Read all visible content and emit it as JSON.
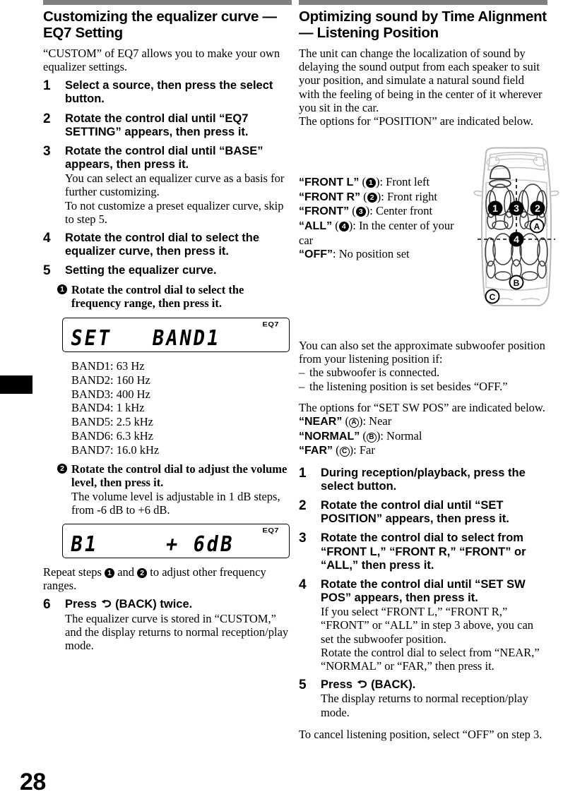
{
  "page": {
    "number": "28"
  },
  "left_column": {
    "title": "Customizing the equalizer curve — EQ7 Setting",
    "intro": "“CUSTOM” of EQ7 allows you to make your own equalizer settings.",
    "steps": [
      {
        "num": "1",
        "head": "Select a source, then press the select button.",
        "sub": ""
      },
      {
        "num": "2",
        "head": "Rotate the control dial until “EQ7 SETTING” appears, then press it.",
        "sub": ""
      },
      {
        "num": "3",
        "head": "Rotate the control dial until “BASE” appears, then press it.",
        "sub": "You can select an equalizer curve as a basis for further customizing.\nTo not customize a preset equalizer curve, skip to step 5."
      },
      {
        "num": "4",
        "head": "Rotate the control dial to select the equalizer curve, then press it.",
        "sub": ""
      },
      {
        "num": "5",
        "head": "Setting the equalizer curve.",
        "sub": ""
      }
    ],
    "substep1": {
      "bullet": "1",
      "head": "Rotate the control dial to select the frequency range, then press it."
    },
    "lcd1": {
      "text": "SET   BAND1",
      "indicator": "EQ7"
    },
    "bands": [
      "BAND1: 63 Hz",
      "BAND2: 160 Hz",
      "BAND3: 400 Hz",
      "BAND4: 1 kHz",
      "BAND5: 2.5 kHz",
      "BAND6: 6.3 kHz",
      "BAND7: 16.0 kHz"
    ],
    "substep2": {
      "bullet": "2",
      "head": "Rotate the control dial to adjust the volume level, then press it.",
      "sub": "The volume level is adjustable in 1 dB steps, from -6 dB to +6 dB."
    },
    "lcd2": {
      "text": "B1     + 6dB",
      "indicator": "EQ7"
    },
    "repeat_prefix": "Repeat steps ",
    "repeat_mid": " and ",
    "repeat_suffix": " to adjust other frequency ranges.",
    "repeat_b1": "1",
    "repeat_b2": "2",
    "step6": {
      "num": "6",
      "head_pre": "Press ",
      "head_post": " (BACK) twice.",
      "sub": "The equalizer curve is stored in “CUSTOM,” and the display returns to normal reception/play mode."
    }
  },
  "right_column": {
    "title": "Optimizing sound by Time Alignment — Listening Position",
    "intro1": "The unit can change the localization of sound by delaying the sound output from each speaker to suit your position, and simulate a natural sound field with the feeling of being in the center of it wherever you sit in the car.",
    "intro2": "The options for “POSITION” are indicated below.",
    "position_options": [
      {
        "label": "“FRONT L”",
        "marker": "1",
        "marker_type": "filled",
        "desc": "): Front left"
      },
      {
        "label": "“FRONT R”",
        "marker": "2",
        "marker_type": "filled",
        "desc": "): Front right"
      },
      {
        "label": "“FRONT”",
        "marker": "3",
        "marker_type": "filled",
        "desc": "): Center front"
      },
      {
        "label": "“ALL”",
        "marker": "4",
        "marker_type": "filled",
        "desc": "): In the center of your car"
      },
      {
        "label": "“OFF”",
        "marker": "",
        "marker_type": "none",
        "desc": ": No position set"
      }
    ],
    "car_diagram": {
      "markers": [
        "1",
        "3",
        "2",
        "4",
        "A",
        "B",
        "C"
      ],
      "caption": ""
    },
    "subwoofer_intro": "You can also set the approximate subwoofer position from your listening position if:",
    "subwoofer_conditions": [
      "the subwoofer is connected.",
      "the listening position is set besides “OFF.”"
    ],
    "sw_options_intro": "The options for “SET SW POS” are indicated below.",
    "sw_options": [
      {
        "label": "“NEAR”",
        "marker": "A",
        "desc": "): Near"
      },
      {
        "label": "“NORMAL”",
        "marker": "B",
        "desc": "): Normal"
      },
      {
        "label": "“FAR”",
        "marker": "C",
        "desc": "): Far"
      }
    ],
    "steps": [
      {
        "num": "1",
        "head": "During reception/playback, press the select button.",
        "sub": ""
      },
      {
        "num": "2",
        "head": "Rotate the control dial until “SET POSITION” appears, then press it.",
        "sub": ""
      },
      {
        "num": "3",
        "head": "Rotate the control dial to select from “FRONT L,” “FRONT R,” “FRONT” or “ALL,” then press it.",
        "sub": ""
      },
      {
        "num": "4",
        "head": "Rotate the control dial until “SET SW POS” appears, then press it.",
        "sub": "If you select “FRONT L,” “FRONT R,” “FRONT” or “ALL” in step 3 above, you can set the subwoofer position.\nRotate the control dial to select from “NEAR,” “NORMAL” or “FAR,” then press it."
      }
    ],
    "step5": {
      "num": "5",
      "head_pre": "Press ",
      "head_post": " (BACK).",
      "sub": "The display returns to normal reception/play mode."
    },
    "closing": "To cancel listening position, select “OFF” on step 3."
  }
}
